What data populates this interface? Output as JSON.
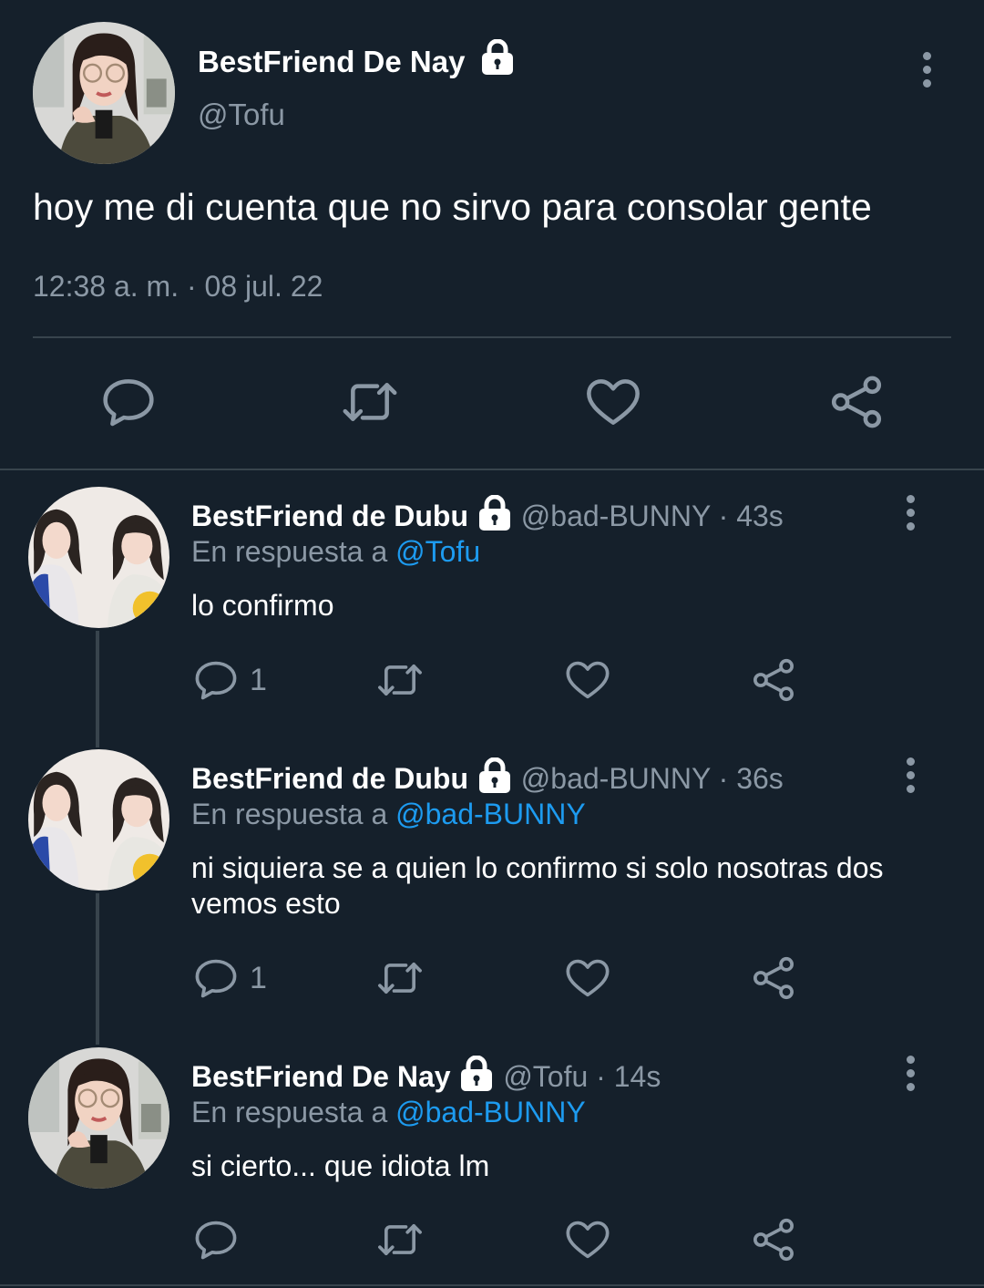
{
  "main_tweet": {
    "display_name": "BestFriend De Nay",
    "handle": "@Tofu",
    "text": "hoy me di cuenta que no sirvo para consolar gente",
    "timestamp": "12:38 a. m. · 08 jul. 22"
  },
  "replies": [
    {
      "display_name": "BestFriend de Dubu",
      "handle": "@bad-BUNNY",
      "time": "· 43s",
      "reply_prefix": "En respuesta a",
      "reply_to": "@Tofu",
      "text": "lo confirmo",
      "reply_count": "1"
    },
    {
      "display_name": "BestFriend de Dubu",
      "handle": "@bad-BUNNY",
      "time": "· 36s",
      "reply_prefix": "En respuesta a",
      "reply_to": "@bad-BUNNY",
      "text": "ni siquiera se a quien lo confirmo si solo nosotras dos vemos esto",
      "reply_count": "1"
    },
    {
      "display_name": "BestFriend De Nay",
      "handle": "@Tofu",
      "time": "· 14s",
      "reply_prefix": "En respuesta a",
      "reply_to": "@bad-BUNNY",
      "text": "si cierto... que idiota lm",
      "reply_count": ""
    }
  ],
  "colors": {
    "background": "#15202b",
    "muted_text": "#8b98a5",
    "link": "#1d9bf0",
    "divider": "#38444d"
  },
  "icons": [
    "lock-icon",
    "more-options-icon",
    "reply-icon",
    "retweet-icon",
    "like-icon",
    "share-icon"
  ]
}
